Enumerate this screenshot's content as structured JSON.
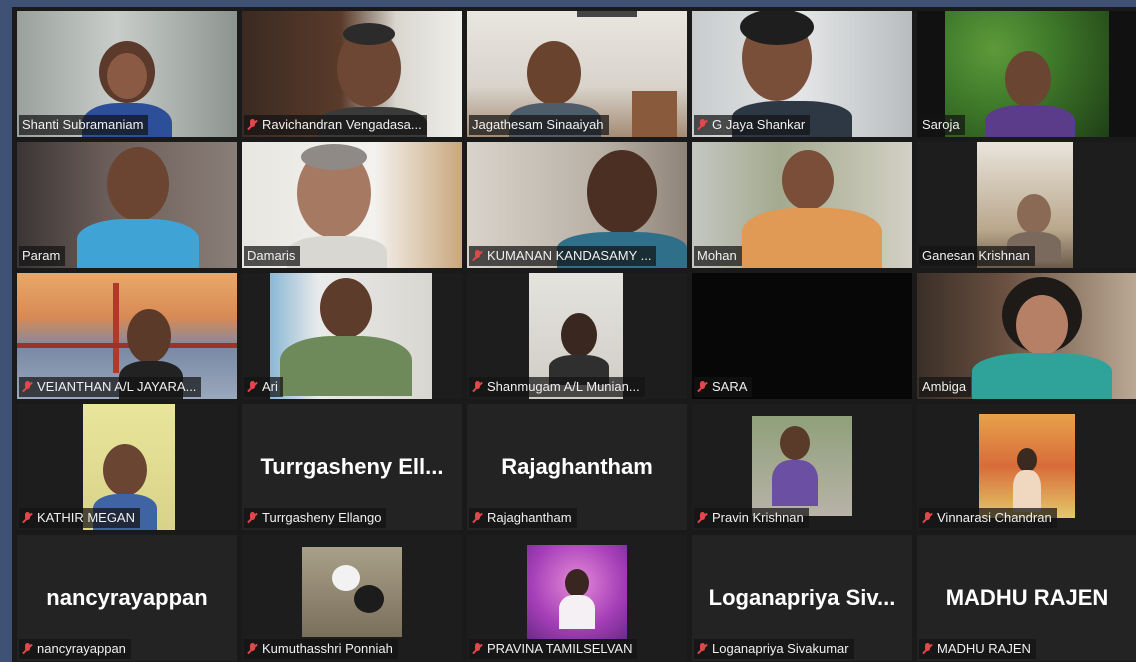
{
  "meeting": {
    "participants": [
      {
        "name": "Shanti Subramaniam",
        "muted": false,
        "active": true,
        "video": true
      },
      {
        "name": "Ravichandran Vengadasa...",
        "muted": true,
        "video": true
      },
      {
        "name": "Jagathesam Sinaaiyah",
        "muted": false,
        "video": true
      },
      {
        "name": "G Jaya Shankar",
        "muted": true,
        "video": true
      },
      {
        "name": "Saroja",
        "muted": false,
        "video": true
      },
      {
        "name": "Param",
        "muted": false,
        "video": true
      },
      {
        "name": "Damaris",
        "muted": false,
        "video": true
      },
      {
        "name": "KUMANAN KANDASAMY ...",
        "muted": true,
        "video": true
      },
      {
        "name": "Mohan",
        "muted": false,
        "video": true
      },
      {
        "name": "Ganesan Krishnan",
        "muted": false,
        "video": true
      },
      {
        "name": "VEIANTHAN A/L JAYARA...",
        "muted": true,
        "video": true
      },
      {
        "name": "Ari",
        "muted": true,
        "video": true
      },
      {
        "name": "Shanmugam A/L Munian...",
        "muted": true,
        "video": true
      },
      {
        "name": "SARA",
        "muted": true,
        "video": false
      },
      {
        "name": "Ambiga",
        "muted": false,
        "video": true
      },
      {
        "name": "KATHIR MEGAN",
        "muted": true,
        "video": true
      },
      {
        "name": "Turrgasheny Ellango",
        "display": "Turrgasheny  Ell...",
        "muted": true,
        "video": false
      },
      {
        "name": "Rajaghantham",
        "display": "Rajaghantham",
        "muted": true,
        "video": false
      },
      {
        "name": "Pravin Krishnan",
        "muted": true,
        "video": true
      },
      {
        "name": "Vinnarasi Chandran",
        "muted": true,
        "video": true
      },
      {
        "name": "nancyrayappan",
        "display": "nancyrayappan",
        "muted": true,
        "video": false
      },
      {
        "name": "Kumuthasshri Ponniah",
        "muted": true,
        "video": true
      },
      {
        "name": "PRAVINA TAMILSELVAN",
        "muted": true,
        "video": true
      },
      {
        "name": "Loganapriya Sivakumar",
        "display": "Loganapriya  Siv...",
        "muted": true,
        "video": false
      },
      {
        "name": "MADHU RAJEN",
        "display": "MADHU RAJEN",
        "muted": true,
        "video": false
      }
    ]
  },
  "colors": {
    "background": "#3f5276",
    "stage": "#1a1a1a",
    "tile": "#232323",
    "active_border": "#c6d62a",
    "muted_icon": "#e0484a"
  }
}
